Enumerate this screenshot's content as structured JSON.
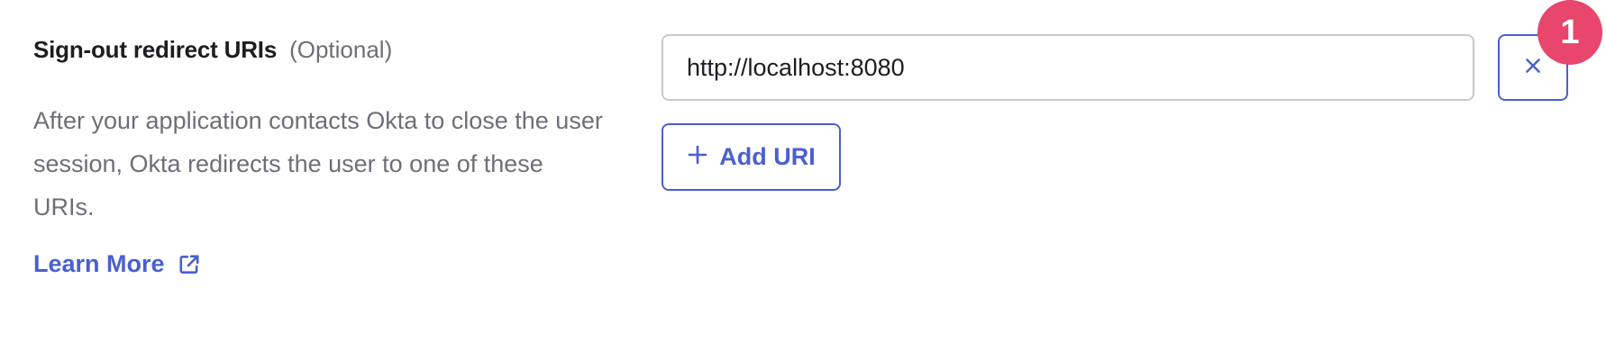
{
  "field": {
    "label": "Sign-out redirect URIs",
    "optional": "(Optional)",
    "description": "After your application contacts Okta to close the user session, Okta redirects the user to one of these URIs.",
    "learn_more": "Learn More"
  },
  "uris": [
    {
      "value": "http://localhost:8080"
    }
  ],
  "buttons": {
    "add_uri": "Add URI"
  },
  "badge": {
    "number": "1"
  },
  "colors": {
    "accent": "#4a5fd1",
    "badge": "#e8466c",
    "muted_text": "#6e6e78",
    "input_border": "#c8c8cf"
  },
  "icons": {
    "learn_more": "external-link-icon",
    "remove": "close-icon",
    "add": "plus-icon"
  }
}
